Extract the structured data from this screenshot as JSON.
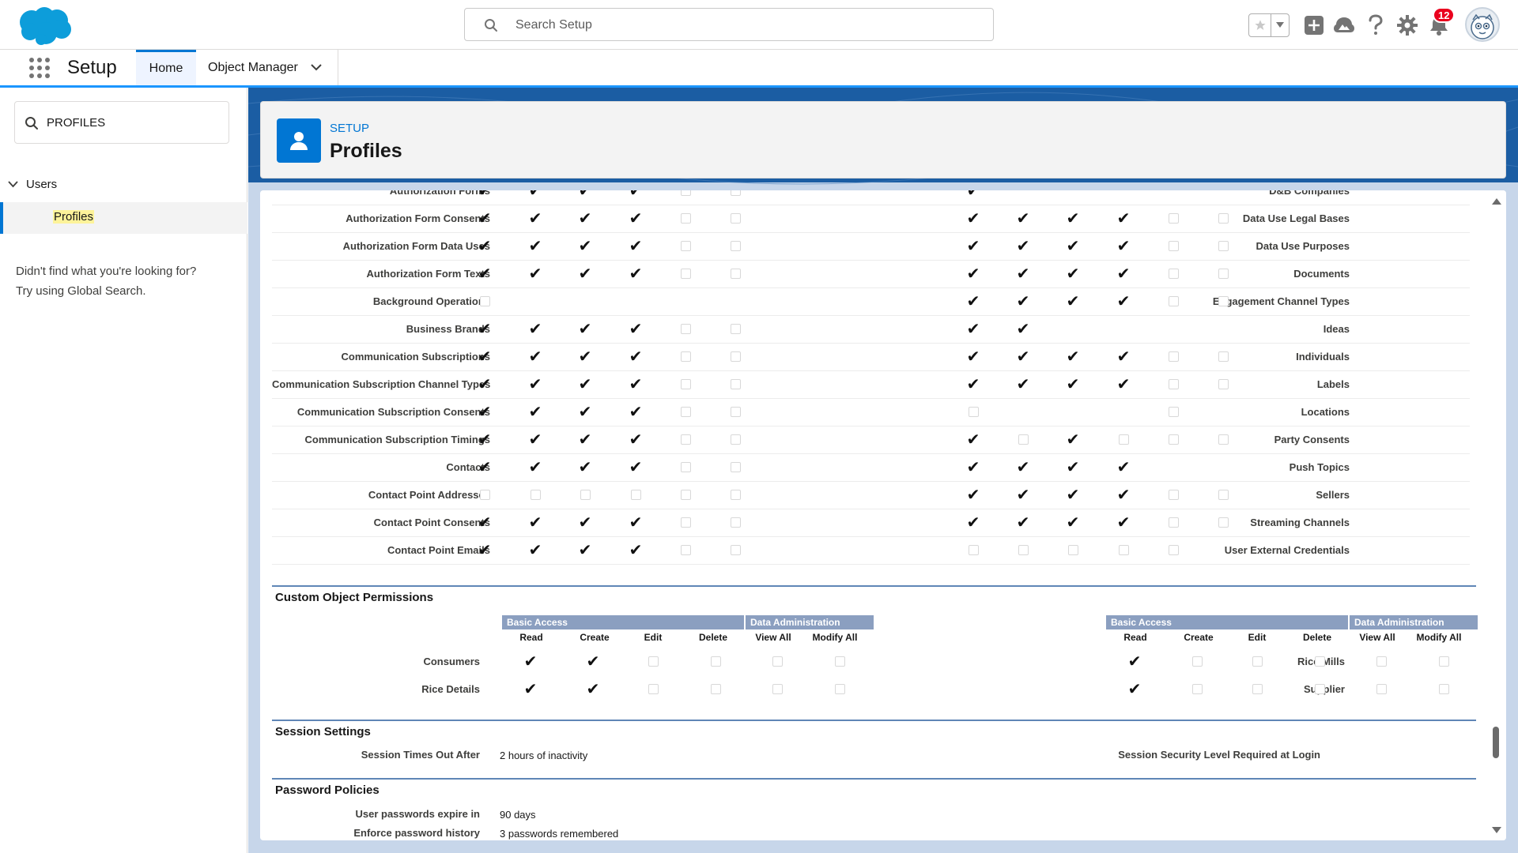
{
  "global_header": {
    "search_placeholder": "Search Setup",
    "notification_count": "12"
  },
  "nav": {
    "app_name": "Setup",
    "tabs": [
      {
        "label": "Home"
      },
      {
        "label": "Object Manager"
      }
    ]
  },
  "sidebar": {
    "quick_find_value": "PROFILES",
    "tree_parent": "Users",
    "tree_child": "Profiles",
    "not_found_line1": "Didn't find what you're looking for?",
    "not_found_line2": "Try using Global Search."
  },
  "page_header": {
    "eyebrow": "SETUP",
    "title": "Profiles"
  },
  "standard_permissions": {
    "left": [
      {
        "label": "Authorization Forms",
        "perms": [
          1,
          1,
          1,
          1,
          0,
          0
        ]
      },
      {
        "label": "Authorization Form Consents",
        "perms": [
          1,
          1,
          1,
          1,
          0,
          0
        ]
      },
      {
        "label": "Authorization Form Data Uses",
        "perms": [
          1,
          1,
          1,
          1,
          0,
          0
        ]
      },
      {
        "label": "Authorization Form Texts",
        "perms": [
          1,
          1,
          1,
          1,
          0,
          0
        ]
      },
      {
        "label": "Background Operations",
        "perms": [
          0,
          null,
          null,
          null,
          null,
          null
        ]
      },
      {
        "label": "Business Brands",
        "perms": [
          1,
          1,
          1,
          1,
          0,
          0
        ]
      },
      {
        "label": "Communication Subscriptions",
        "perms": [
          1,
          1,
          1,
          1,
          0,
          0
        ]
      },
      {
        "label": "Communication Subscription Channel Types",
        "perms": [
          1,
          1,
          1,
          1,
          0,
          0
        ]
      },
      {
        "label": "Communication Subscription Consents",
        "perms": [
          1,
          1,
          1,
          1,
          0,
          0
        ]
      },
      {
        "label": "Communication Subscription Timings",
        "perms": [
          1,
          1,
          1,
          1,
          0,
          0
        ]
      },
      {
        "label": "Contacts",
        "perms": [
          1,
          1,
          1,
          1,
          0,
          0
        ]
      },
      {
        "label": "Contact Point Addresses",
        "perms": [
          0,
          0,
          0,
          0,
          0,
          0
        ]
      },
      {
        "label": "Contact Point Consents",
        "perms": [
          1,
          1,
          1,
          1,
          0,
          0
        ]
      },
      {
        "label": "Contact Point Emails",
        "perms": [
          1,
          1,
          1,
          1,
          0,
          0
        ]
      }
    ],
    "right": [
      {
        "label": "D&B Companies",
        "perms": [
          1,
          null,
          null,
          null,
          null,
          null
        ]
      },
      {
        "label": "Data Use Legal Bases",
        "perms": [
          1,
          1,
          1,
          1,
          0,
          0
        ]
      },
      {
        "label": "Data Use Purposes",
        "perms": [
          1,
          1,
          1,
          1,
          0,
          0
        ]
      },
      {
        "label": "Documents",
        "perms": [
          1,
          1,
          1,
          1,
          0,
          0
        ]
      },
      {
        "label": "Engagement Channel Types",
        "perms": [
          1,
          1,
          1,
          1,
          0,
          0
        ]
      },
      {
        "label": "Ideas",
        "perms": [
          1,
          1,
          null,
          null,
          null,
          null
        ]
      },
      {
        "label": "Individuals",
        "perms": [
          1,
          1,
          1,
          1,
          0,
          0
        ]
      },
      {
        "label": "Labels",
        "perms": [
          1,
          1,
          1,
          1,
          0,
          0
        ]
      },
      {
        "label": "Locations",
        "perms": [
          0,
          null,
          null,
          null,
          0,
          null
        ]
      },
      {
        "label": "Party Consents",
        "perms": [
          1,
          0,
          1,
          0,
          0,
          0
        ]
      },
      {
        "label": "Push Topics",
        "perms": [
          1,
          1,
          1,
          1,
          null,
          null
        ]
      },
      {
        "label": "Sellers",
        "perms": [
          1,
          1,
          1,
          1,
          0,
          0
        ]
      },
      {
        "label": "Streaming Channels",
        "perms": [
          1,
          1,
          1,
          1,
          0,
          0
        ]
      },
      {
        "label": "User External Credentials",
        "perms": [
          0,
          0,
          0,
          0,
          0,
          null
        ]
      }
    ]
  },
  "custom_object_permissions": {
    "title": "Custom Object Permissions",
    "group_basic": "Basic Access",
    "group_admin": "Data Administration",
    "columns": [
      "Read",
      "Create",
      "Edit",
      "Delete",
      "View All",
      "Modify All"
    ],
    "left": [
      {
        "label": "Consumers",
        "perms": [
          1,
          1,
          0,
          0,
          0,
          0
        ]
      },
      {
        "label": "Rice Details",
        "perms": [
          1,
          1,
          0,
          0,
          0,
          0
        ]
      }
    ],
    "right": [
      {
        "label": "Rice Mills",
        "perms": [
          1,
          0,
          0,
          0,
          0,
          0
        ]
      },
      {
        "label": "Supplier",
        "perms": [
          1,
          0,
          0,
          0,
          0,
          0
        ]
      }
    ]
  },
  "session_settings": {
    "title": "Session Settings",
    "timeout_label": "Session Times Out After",
    "timeout_value": "2 hours of inactivity",
    "security_label": "Session Security Level Required at Login",
    "security_value": ""
  },
  "password_policies": {
    "title": "Password Policies",
    "expire_label": "User passwords expire in",
    "expire_value": "90 days",
    "history_label": "Enforce password history",
    "history_value": "3 passwords remembered"
  },
  "colors": {
    "brand_blue": "#0176d3",
    "section_line": "#1b5297",
    "group_header": "#8b9fc0",
    "highlight": "#fdf39a",
    "badge_red": "#ea001e"
  }
}
